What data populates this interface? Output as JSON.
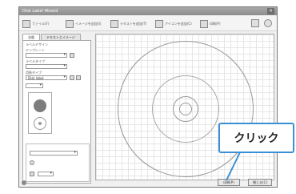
{
  "window": {
    "title": "Disk Label Wizard",
    "close_symbol": "×"
  },
  "toolbar": {
    "items": [
      {
        "icon": "file-icon",
        "label": "ファイル(F)"
      },
      {
        "icon": "image-icon",
        "label": "イメージを追加(I)"
      },
      {
        "icon": "text-icon",
        "label": "テキストを追加(T)"
      },
      {
        "icon": "icon-add-icon",
        "label": "アイコンを追加(C)"
      },
      {
        "icon": "print-icon",
        "label": "印刷(P)"
      }
    ]
  },
  "left_panel": {
    "tabs": [
      "全般",
      "テキストとイメージ"
    ],
    "section_label": "ラベルデザイン",
    "field1_label": "テンプレート",
    "field2_label": "ラベルタイプ",
    "field3_label": "用紙タイプ",
    "value_text": "Disk label"
  },
  "callout": {
    "text": "クリック"
  },
  "buttons": {
    "ok": "印刷(P)",
    "cancel": "閉じる(C)"
  },
  "colors": {
    "accent": "#3a8fd6"
  }
}
